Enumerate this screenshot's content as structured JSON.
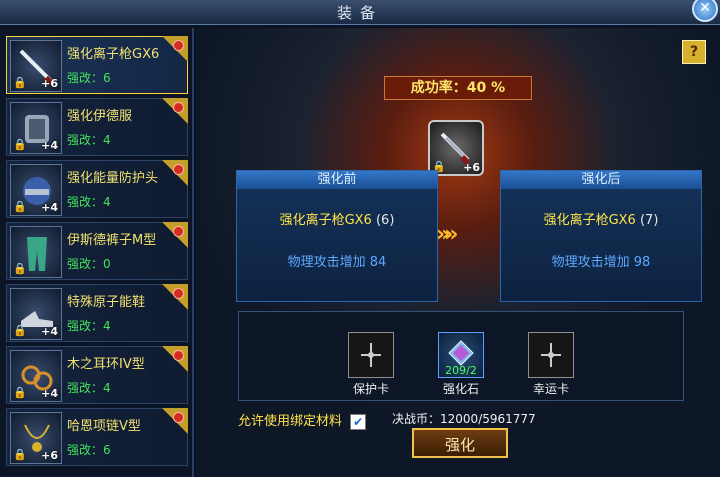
{
  "window": {
    "title": "装备",
    "close_label": "✕"
  },
  "help_label": "?",
  "items": [
    {
      "name": "强化离子枪GX6",
      "enhance": "强改：6",
      "plus": "+6",
      "icon": "gun-icon",
      "selected": true
    },
    {
      "name": "强化伊德服",
      "enhance": "强改：4",
      "plus": "+4",
      "icon": "armor-icon",
      "selected": false
    },
    {
      "name": "强化能量防护头",
      "enhance": "强改：4",
      "plus": "+4",
      "icon": "helmet-icon",
      "selected": false
    },
    {
      "name": "伊斯德裤子M型",
      "enhance": "强改：0",
      "plus": "",
      "icon": "pants-icon",
      "selected": false
    },
    {
      "name": "特殊原子能鞋",
      "enhance": "强改：4",
      "plus": "+4",
      "icon": "shoes-icon",
      "selected": false
    },
    {
      "name": "木之耳环IV型",
      "enhance": "强改：4",
      "plus": "+4",
      "icon": "earring-icon",
      "selected": false
    },
    {
      "name": "哈恩项链V型",
      "enhance": "强改：6",
      "plus": "+6",
      "icon": "necklace-icon",
      "selected": false
    }
  ],
  "enhance": {
    "success_rate_label": "成功率：40 %",
    "center_plus": "+6",
    "before": {
      "title": "强化前",
      "item_name": "强化离子枪GX6",
      "level": "(6)",
      "stat": "物理攻击增加 84"
    },
    "after": {
      "title": "强化后",
      "item_name": "强化离子枪GX6",
      "level": "(7)",
      "stat": "物理攻击增加 98"
    },
    "arrows": "»»"
  },
  "materials": [
    {
      "label": "保护卡",
      "count": "",
      "icon": "protect-card-icon"
    },
    {
      "label": "强化石",
      "count": "209/2",
      "icon": "enhance-stone-icon"
    },
    {
      "label": "幸运卡",
      "count": "",
      "icon": "luck-card-icon"
    }
  ],
  "bottom": {
    "bind_label": "允许使用绑定材料",
    "checkbox_mark": "✔",
    "currency_label": "决战币：",
    "currency_value": "12000/5961777",
    "enhance_button": "强化"
  },
  "colors": {
    "accent_gold": "#ffd23a",
    "green_text": "#42e35a",
    "blue_stat": "#5fa8ff"
  }
}
